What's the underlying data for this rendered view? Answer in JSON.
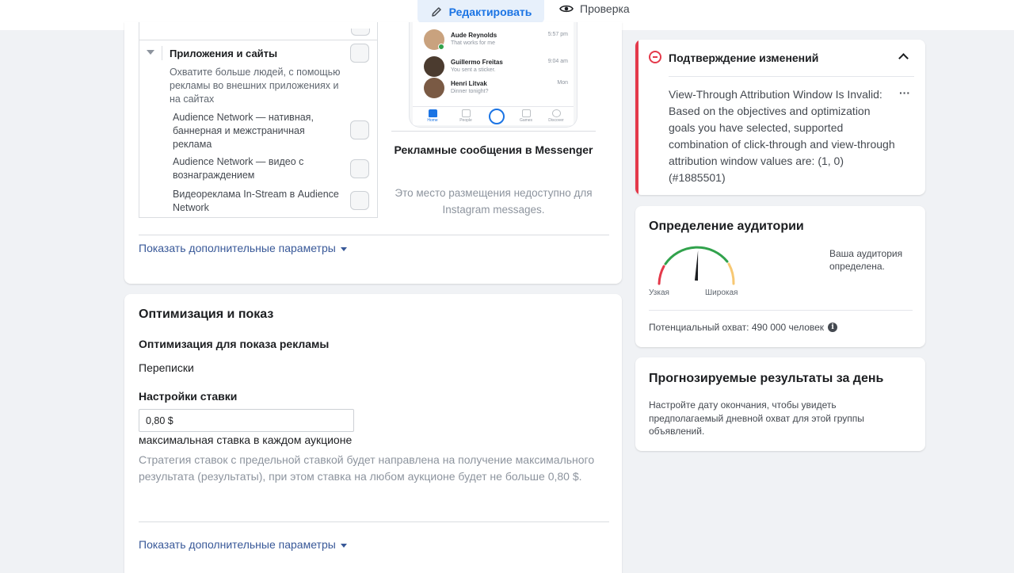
{
  "topbar": {
    "edit_label": "Редактировать",
    "review_label": "Проверка"
  },
  "placements": {
    "section_title": "Приложения и сайты",
    "section_description": "Охватите больше людей, с помощью рекламы во внешних приложениях и на сайтах",
    "items": [
      {
        "label": "Audience Network — нативная, баннерная и межстраничная реклама"
      },
      {
        "label": "Audience Network — видео с вознаграждением"
      },
      {
        "label": "Видеореклама In-Stream в Audience Network"
      }
    ],
    "show_more": "Показать дополнительные параметры"
  },
  "preview": {
    "chats": [
      {
        "name": "Aude Reynolds",
        "message": "That works for me",
        "time": "5:57 pm"
      },
      {
        "name": "Guillermo Freitas",
        "message": "You sent a sticker.",
        "time": "9:04 am"
      },
      {
        "name": "Henri Litvak",
        "message": "Dinner tonight?",
        "time": "Mon"
      }
    ],
    "nav": [
      "Home",
      "People",
      "Games",
      "Discover"
    ],
    "title": "Рекламные сообщения в Messenger",
    "note": "Это место размещения недоступно для Instagram messages."
  },
  "optimization": {
    "title": "Оптимизация и показ",
    "goal_label": "Оптимизация для показа рекламы",
    "goal_value": "Переписки",
    "bid_label": "Настройки ставки",
    "bid_value": "0,80 $",
    "bid_caption": "максимальная ставка в каждом аукционе",
    "bid_description": "Стратегия ставок с предельной ставкой будет направлена на получение максимального результата (результаты), при этом ставка на любом аукционе будет не больше 0,80 $.",
    "show_more": "Показать дополнительные параметры"
  },
  "confirm": {
    "title": "Подтверждение изменений",
    "message": "View-Through Attribution Window Is Invalid: Based on the objectives and optimization goals you have selected, supported combination of click-through and view-through attribution window values are: (1, 0) (#1885501)",
    "more": "···"
  },
  "audience": {
    "title": "Определение аудитории",
    "narrow": "Узкая",
    "wide": "Широкая",
    "status": "Ваша аудитория определена.",
    "reach": "Потенциальный охват: 490 000 человек",
    "info": "i",
    "gauge_level": 0.52
  },
  "forecast": {
    "title": "Прогнозируемые результаты за день",
    "text": "Настройте дату окончания, чтобы увидеть предполагаемый дневной охват для этой группы объявлений."
  },
  "colors": {
    "accent": "#1b74e4",
    "link": "#385898",
    "error": "#e4394a",
    "gauge_green": "#31a24c",
    "gauge_red": "#e4394a",
    "gauge_yellow": "#f7c873"
  }
}
